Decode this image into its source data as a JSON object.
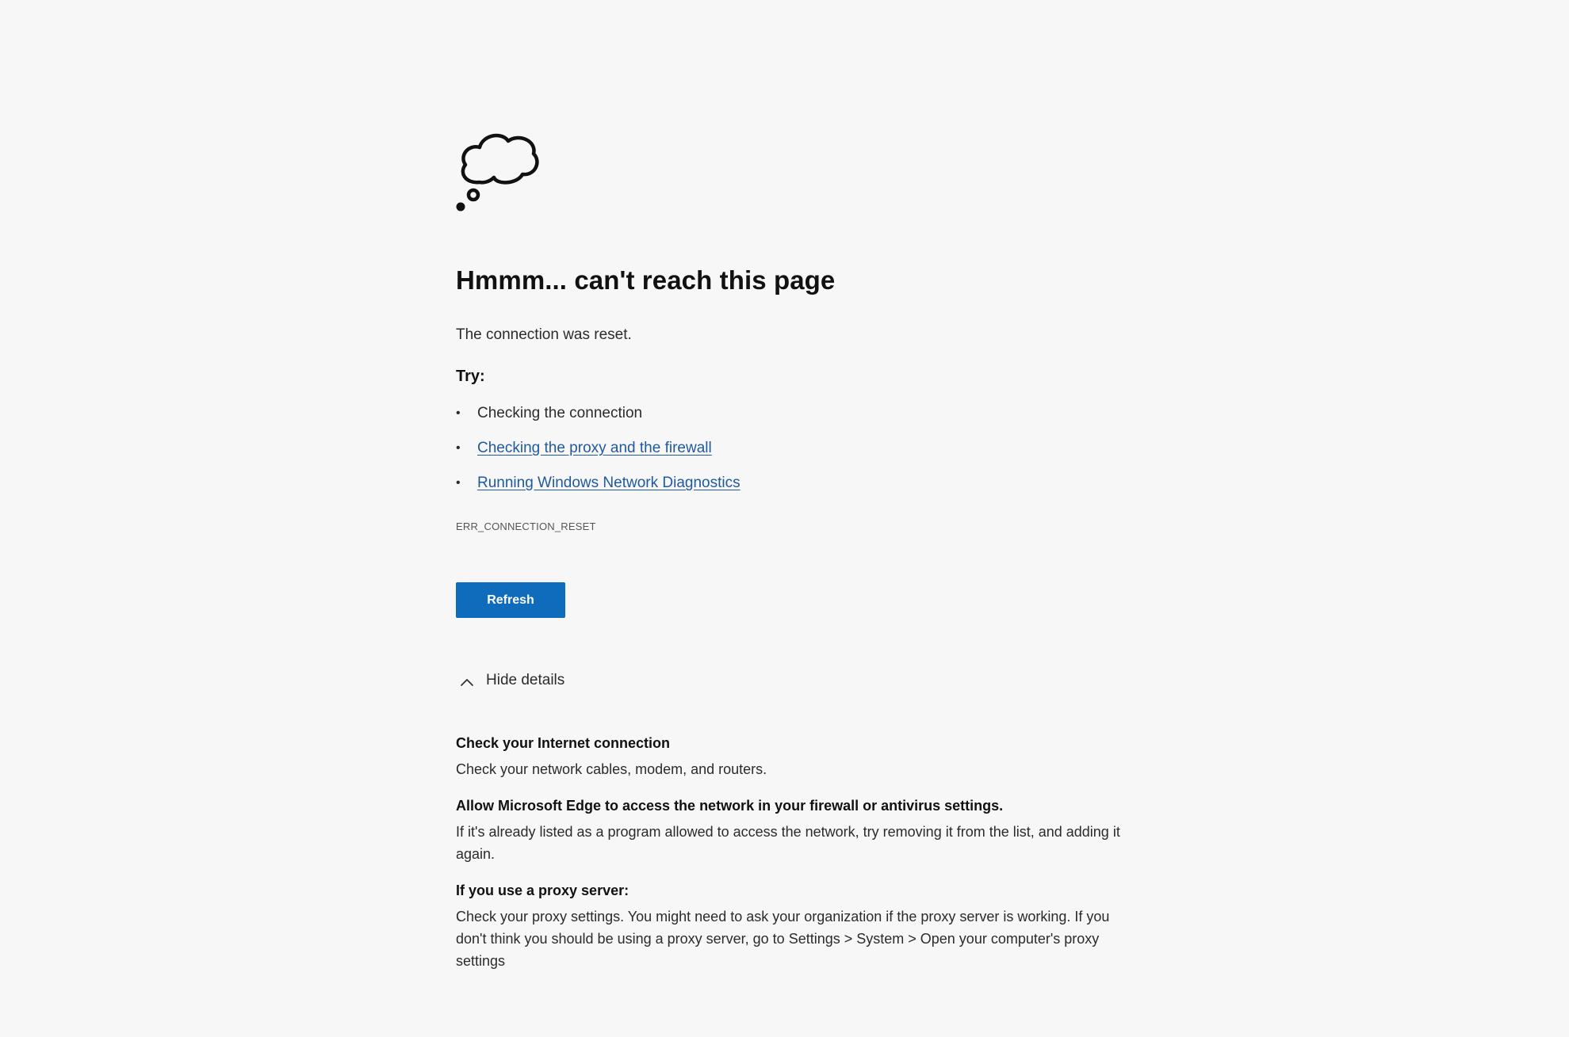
{
  "icon": "thought-bubble-icon",
  "title": "Hmmm... can't reach this page",
  "description": "The connection was reset.",
  "try_label": "Try:",
  "suggestions": [
    {
      "text": "Checking the connection",
      "link": false
    },
    {
      "text": "Checking the proxy and the firewall",
      "link": true
    },
    {
      "text": "Running Windows Network Diagnostics",
      "link": true
    }
  ],
  "error_code": "ERR_CONNECTION_RESET",
  "refresh_label": "Refresh",
  "details_toggle_label": "Hide details",
  "details": [
    {
      "heading": "Check your Internet connection",
      "body": "Check your network cables, modem, and routers."
    },
    {
      "heading": "Allow Microsoft Edge to access the network in your firewall or antivirus settings.",
      "body": "If it's already listed as a program allowed to access the network, try removing it from the list, and adding it again."
    },
    {
      "heading": "If you use a proxy server:",
      "body": "Check your proxy settings. You might need to ask your organization if the proxy server is working. If you don't think you should be using a proxy server, go to Settings > System > Open your computer's proxy settings"
    }
  ],
  "colors": {
    "background": "#f7f7f7",
    "button": "#0f6cbd",
    "link": "#1f5aa0"
  }
}
